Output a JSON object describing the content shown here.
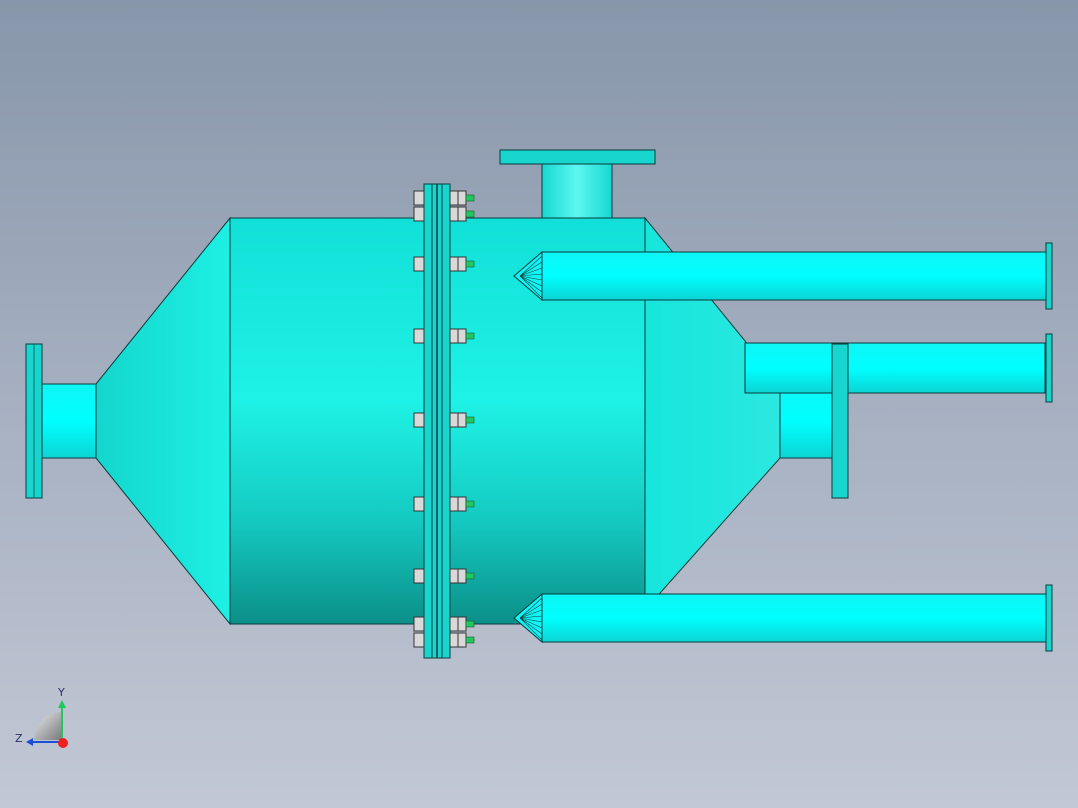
{
  "view": {
    "background_top": "#8796aa",
    "background_bottom": "#c2c8d5"
  },
  "model": {
    "body_color": "#1ee8e0",
    "pipe_color": "#00ffff",
    "outline_color": "#0b3b3b",
    "bolt_color": "#d9d9d9",
    "bolt_tip_color": "#22c55e"
  },
  "triad": {
    "y_label": "Y",
    "z_label": "Z",
    "y_color": "#22c55e",
    "z_color": "#1d4ed8",
    "x_color": "#ef2020"
  }
}
